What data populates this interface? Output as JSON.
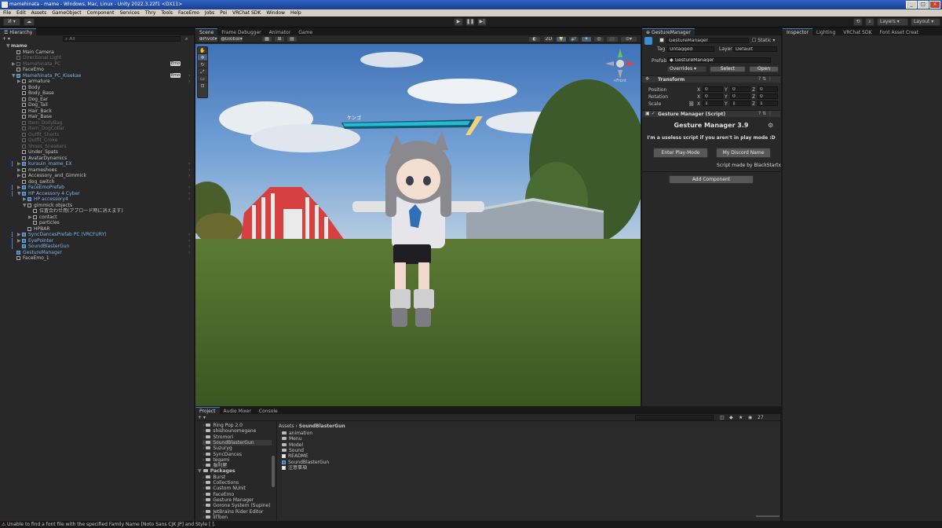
{
  "window": {
    "title": "mamehinata - mame - Windows, Mac, Linux - Unity 2022.3.22f1 <DX11>"
  },
  "menubar": {
    "items": [
      "File",
      "Edit",
      "Assets",
      "GameObject",
      "Component",
      "Services",
      "Thry",
      "Tools",
      "FaceEmo",
      "Jobs",
      "Poi",
      "VRChat SDK",
      "Window",
      "Help"
    ]
  },
  "toolbar": {
    "account": "И",
    "layers": "Layers",
    "layout": "Layout"
  },
  "hierarchy": {
    "tab": "Hierarchy",
    "search_placeholder": "All",
    "rows": [
      {
        "text": "mame",
        "indent": 0,
        "type": "scene",
        "arrow": "▼"
      },
      {
        "text": "Main Camera",
        "indent": 1,
        "type": "go",
        "arrow": ""
      },
      {
        "text": "Directional Light",
        "indent": 1,
        "type": "dis",
        "arrow": ""
      },
      {
        "text": "Mamehinata_PC",
        "indent": 1,
        "type": "dis",
        "arrow": "▶"
      },
      {
        "text": "FaceEmo",
        "indent": 1,
        "type": "go",
        "arrow": ""
      },
      {
        "text": "Mamehinata_PC_Kisekae",
        "indent": 1,
        "type": "pf",
        "arrow": "▼"
      },
      {
        "text": "armature",
        "indent": 2,
        "type": "go",
        "arrow": "▶"
      },
      {
        "text": "Body",
        "indent": 2,
        "type": "go",
        "arrow": ""
      },
      {
        "text": "Body_Base",
        "indent": 2,
        "type": "go",
        "arrow": ""
      },
      {
        "text": "Dog_Ear",
        "indent": 2,
        "type": "go",
        "arrow": ""
      },
      {
        "text": "Dog_Tail",
        "indent": 2,
        "type": "go",
        "arrow": ""
      },
      {
        "text": "Hair_Back",
        "indent": 2,
        "type": "go",
        "arrow": ""
      },
      {
        "text": "Hair_Base",
        "indent": 2,
        "type": "go",
        "arrow": ""
      },
      {
        "text": "Item_DollyBag",
        "indent": 2,
        "type": "dis",
        "arrow": ""
      },
      {
        "text": "Item_DogCollar",
        "indent": 2,
        "type": "dis",
        "arrow": ""
      },
      {
        "text": "Outfit_Shorts",
        "indent": 2,
        "type": "dis",
        "arrow": ""
      },
      {
        "text": "Outfit_Croke",
        "indent": 2,
        "type": "dis",
        "arrow": ""
      },
      {
        "text": "Shoes_Sneakers",
        "indent": 2,
        "type": "dis",
        "arrow": ""
      },
      {
        "text": "Under_Spats",
        "indent": 2,
        "type": "go",
        "arrow": ""
      },
      {
        "text": "AvatarDynamics",
        "indent": 2,
        "type": "go",
        "arrow": ""
      },
      {
        "text": "kurauin_mame_EX",
        "indent": 2,
        "type": "pf",
        "arrow": "▶"
      },
      {
        "text": "mameshoes",
        "indent": 2,
        "type": "go",
        "arrow": "▶"
      },
      {
        "text": "Accessory_and_Gimmick",
        "indent": 2,
        "type": "go",
        "arrow": "▶"
      },
      {
        "text": "dog_switch",
        "indent": 2,
        "type": "go",
        "arrow": ""
      },
      {
        "text": "FaceEmoPrefab",
        "indent": 2,
        "type": "pf",
        "arrow": "▶"
      },
      {
        "text": "HP Accessory 4 Cyber",
        "indent": 2,
        "type": "pf",
        "arrow": "▼"
      },
      {
        "text": "HP accessory4",
        "indent": 3,
        "type": "pf",
        "arrow": "▶"
      },
      {
        "text": "gimmick objects",
        "indent": 3,
        "type": "go",
        "arrow": "▼"
      },
      {
        "text": "位置合わせ用(アプロード時に消えます)",
        "indent": 4,
        "type": "go",
        "arrow": ""
      },
      {
        "text": "contact",
        "indent": 4,
        "type": "go",
        "arrow": "▶"
      },
      {
        "text": "particles",
        "indent": 4,
        "type": "go",
        "arrow": ""
      },
      {
        "text": "HPBAR",
        "indent": 3,
        "type": "go",
        "arrow": ""
      },
      {
        "text": "SyncDancesPrefab PC (VRCFURY)",
        "indent": 2,
        "type": "pf",
        "arrow": "▶"
      },
      {
        "text": "EyePointer",
        "indent": 2,
        "type": "pf",
        "arrow": "▶"
      },
      {
        "text": "SoundBlasterGun",
        "indent": 2,
        "type": "pf",
        "arrow": ""
      },
      {
        "text": "GestureManager",
        "indent": 1,
        "type": "pf",
        "arrow": ""
      },
      {
        "text": "FaceEmo_1",
        "indent": 1,
        "type": "go",
        "arrow": ""
      }
    ],
    "emo_badge": "Emo"
  },
  "scene": {
    "tabs": [
      "Scene",
      "Frame Debugger",
      "Animator",
      "Game"
    ],
    "pivot": "Pivot",
    "global": "Global",
    "nameplate": "ケンゴ",
    "gizmo_label": "<Front"
  },
  "bottom": {
    "tabs": [
      "Project",
      "Audio Mixer",
      "Console"
    ],
    "tree": [
      {
        "text": "Ring Pop 2.0",
        "indent": 1
      },
      {
        "text": "shishounomegane",
        "indent": 1
      },
      {
        "text": "Stromori",
        "indent": 1
      },
      {
        "text": "SoundBlasterGun",
        "indent": 1,
        "selected": true
      },
      {
        "text": "Suzuryg",
        "indent": 1
      },
      {
        "text": "SyncDances",
        "indent": 1
      },
      {
        "text": "tegami",
        "indent": 1
      },
      {
        "text": "服利屋",
        "indent": 1
      },
      {
        "text": "Packages",
        "indent": 0,
        "bold": true
      },
      {
        "text": "Burst",
        "indent": 1
      },
      {
        "text": "Collections",
        "indent": 1
      },
      {
        "text": "Custom NUnit",
        "indent": 1
      },
      {
        "text": "FaceEmo",
        "indent": 1
      },
      {
        "text": "Gesture Manager",
        "indent": 1
      },
      {
        "text": "Gorone System (Supine)",
        "indent": 1
      },
      {
        "text": "JetBrains Rider Editor",
        "indent": 1
      },
      {
        "text": "lilToon",
        "indent": 1
      }
    ],
    "breadcrumb_root": "Assets",
    "breadcrumb_folder": "SoundBlasterGun",
    "files": [
      {
        "text": "animation",
        "kind": "folder"
      },
      {
        "text": "Menu",
        "kind": "folder"
      },
      {
        "text": "Model",
        "kind": "folder"
      },
      {
        "text": "Sound",
        "kind": "folder"
      },
      {
        "text": "README",
        "kind": "file"
      },
      {
        "text": "SoundBlasterGun",
        "kind": "prefab"
      },
      {
        "text": "注意事項",
        "kind": "file"
      }
    ],
    "item_count": "27"
  },
  "gesture": {
    "tab": "GestureManager",
    "object_name": "GestureManager",
    "static_label": "Static",
    "tag_label": "Tag",
    "tag_value": "Untagged",
    "layer_label": "Layer",
    "layer_value": "Default",
    "prefab_label": "Prefab",
    "prefab_value": "GestureManager",
    "overrides": "Overrides",
    "select": "Select",
    "open": "Open",
    "transform_title": "Transform",
    "position_label": "Position",
    "rotation_label": "Rotation",
    "scale_label": "Scale",
    "position": [
      "0",
      "0",
      "0"
    ],
    "rotation": [
      "0",
      "0",
      "0"
    ],
    "scale": [
      "1",
      "1",
      "1"
    ],
    "script_title": "Gesture Manager (Script)",
    "heading": "Gesture Manager 3.9",
    "subtitle": "I'm a useless script if you aren't in play mode :D",
    "enter_play": "Enter Play-Mode",
    "discord": "My Discord Name",
    "credit": "Script made by BlackStartx",
    "add_component": "Add Component"
  },
  "inspector": {
    "tabs": [
      "Inspector",
      "Lighting",
      "VRChat SDK",
      "Font Asset Creat"
    ]
  },
  "status": {
    "message": "Unable to find a font file with the specified Family Name [Noto Sans CJK JP] and Style [ ]."
  },
  "colors": {
    "accent": "#3a79bb",
    "prefab": "#7fb4ee",
    "selection": "#2c5d87"
  }
}
